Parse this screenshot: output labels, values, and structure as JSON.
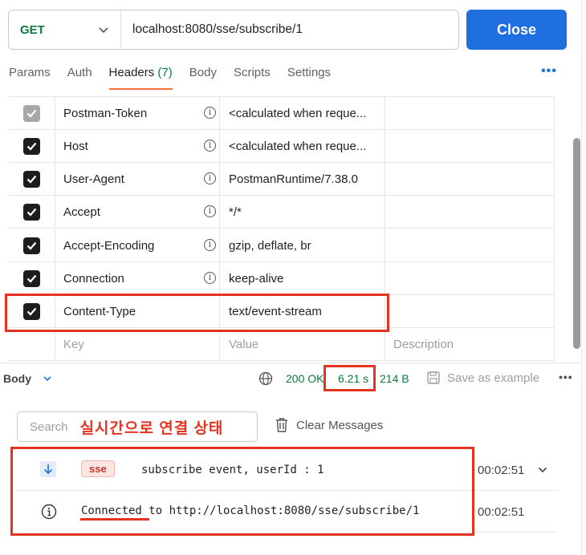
{
  "request": {
    "method": "GET",
    "url": "localhost:8080/sse/subscribe/1",
    "close_label": "Close"
  },
  "tabs": [
    {
      "label": "Params"
    },
    {
      "label": "Auth"
    },
    {
      "label": "Headers",
      "count": "(7)",
      "active": true
    },
    {
      "label": "Body"
    },
    {
      "label": "Scripts"
    },
    {
      "label": "Settings"
    }
  ],
  "more_icon": "ellipsis-icon",
  "headers": {
    "rows": [
      {
        "checked": true,
        "disabled": true,
        "key": "Postman-Token",
        "value": "<calculated when reque...",
        "info": true
      },
      {
        "checked": true,
        "key": "Host",
        "value": "<calculated when reque...",
        "info": true
      },
      {
        "checked": true,
        "key": "User-Agent",
        "value": "PostmanRuntime/7.38.0",
        "info": true
      },
      {
        "checked": true,
        "key": "Accept",
        "value": "*/*",
        "info": true
      },
      {
        "checked": true,
        "key": "Accept-Encoding",
        "value": "gzip, deflate, br",
        "info": true
      },
      {
        "checked": true,
        "key": "Connection",
        "value": "keep-alive",
        "info": true
      },
      {
        "checked": true,
        "key": "Content-Type",
        "value": "text/event-stream",
        "info": false
      }
    ],
    "placeholders": {
      "key": "Key",
      "value": "Value",
      "description": "Description"
    }
  },
  "response": {
    "body_label": "Body",
    "status": "200 OK",
    "time": "6.21 s",
    "size": "214 B",
    "save_label": "Save as example"
  },
  "messages_panel": {
    "search_placeholder": "Search",
    "annotation": "실시간으로 연결 상태",
    "clear_label": "Clear Messages",
    "messages": [
      {
        "badge": "sse",
        "text": "subscribe event, userId : 1",
        "time": "00:02:51"
      },
      {
        "text_connected": "Connected",
        "text_rest": " to http://localhost:8080/sse/subscribe/1",
        "time": "00:02:51"
      }
    ]
  },
  "colors": {
    "accent": "#1f6fe0",
    "success": "#0b7a3b",
    "annotation_red": "#e53322",
    "tab_underline": "#ff6c37"
  }
}
